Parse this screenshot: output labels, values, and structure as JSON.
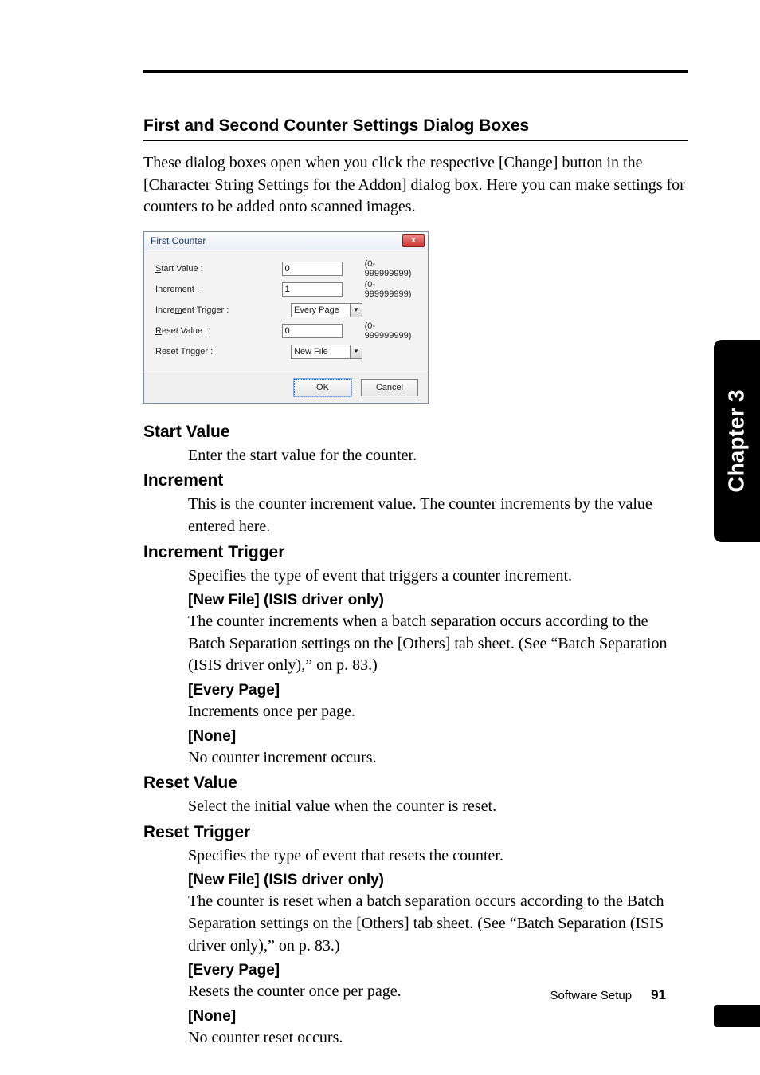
{
  "chapter_tab": "Chapter 3",
  "heading": "First and Second Counter Settings Dialog Boxes",
  "intro": "These dialog boxes open when you click the respective [Change] button in the [Character String Settings for the Addon] dialog box. Here you can make settings for counters to be added onto scanned images.",
  "dialog": {
    "title": "First Counter",
    "close": "x",
    "start_value": {
      "label_pre": "S",
      "label_post": "tart Value :",
      "value": "0",
      "range": "(0-999999999)"
    },
    "increment": {
      "label_pre": "I",
      "label_post": "ncrement :",
      "value": "1",
      "range": "(0-999999999)"
    },
    "inc_trigger": {
      "label": "Increment Trigger :",
      "label_underline_char": "m",
      "value": "Every Page"
    },
    "reset_value": {
      "label_pre": "R",
      "label_post": "eset Value :",
      "value": "0",
      "range": "(0-999999999)"
    },
    "reset_trigger": {
      "label": "Reset Trigger :",
      "value": "New File"
    },
    "ok": "OK",
    "cancel": "Cancel"
  },
  "defs": {
    "start_value": {
      "h": "Start Value",
      "p": "Enter the start value for the counter."
    },
    "increment": {
      "h": "Increment",
      "p": "This is the counter increment value. The counter increments by the value entered here."
    },
    "inc_trigger": {
      "h": "Increment Trigger",
      "p": "Specifies the type of event that triggers a counter increment.",
      "newfile": {
        "h": "[New File] (ISIS driver only)",
        "p": "The counter increments when a batch separation occurs according to the Batch Separation settings on the [Others] tab sheet. (See “Batch Separation (ISIS driver only),” on p. 83.)"
      },
      "every": {
        "h": "[Every Page]",
        "p": "Increments once per page."
      },
      "none": {
        "h": "[None]",
        "p": "No counter increment occurs."
      }
    },
    "reset_value": {
      "h": "Reset Value",
      "p": "Select the initial value when the counter is reset."
    },
    "reset_trigger": {
      "h": "Reset Trigger",
      "p": "Specifies the type of event that resets the counter.",
      "newfile": {
        "h": "[New File] (ISIS driver only)",
        "p": "The counter is reset when a batch separation occurs according to the Batch Separation settings on the [Others] tab sheet. (See “Batch Separation (ISIS driver only),” on p. 83.)"
      },
      "every": {
        "h": "[Every Page]",
        "p": "Resets the counter once per page."
      },
      "none": {
        "h": "[None]",
        "p": "No counter reset occurs."
      }
    }
  },
  "footer": {
    "section": "Software Setup",
    "page": "91"
  }
}
